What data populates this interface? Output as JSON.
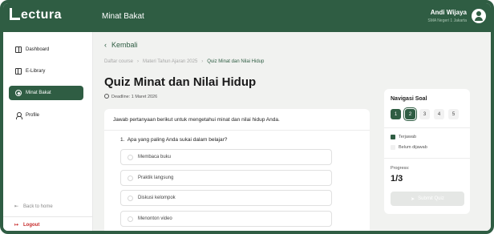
{
  "app": {
    "logo": "ectura",
    "logo_first_letter": "L"
  },
  "header": {
    "page_title": "Minat Bakat",
    "user_name": "Andi Wijaya",
    "user_school": "SMA Negeri 1 Jakarta"
  },
  "sidebar": {
    "items": [
      {
        "label": "Dashboard",
        "icon": "grid-icon"
      },
      {
        "label": "E-Library",
        "icon": "book-icon"
      },
      {
        "label": "Minat Bakat",
        "icon": "compass-icon",
        "active": true
      },
      {
        "label": "Profile",
        "icon": "user-icon"
      }
    ],
    "back_home": "Back to home",
    "logout": "Logout"
  },
  "main": {
    "back_label": "Kembali",
    "breadcrumb": [
      "Daftar course",
      "Materi Tahun Ajaran 2025",
      "Quiz Minat dan Nilai Hidup"
    ],
    "title": "Quiz Minat dan Nilai Hidup",
    "deadline": "Deadline: 1 Maret 2026",
    "instruction": "Jawab pertanyaan berikut untuk mengetahui minat dan nilai hidup Anda.",
    "question_number": "1.",
    "question": "Apa yang paling Anda sukai dalam belajar?",
    "options": [
      "Membaca buku",
      "Praktik langsung",
      "Diskusi kelompok",
      "Menonton video"
    ]
  },
  "navigation": {
    "title": "Navigasi Soal",
    "numbers": [
      "1",
      "2",
      "3",
      "4",
      "5"
    ],
    "legend_answered": "Terjawab",
    "legend_unanswered": "Belum dijawab",
    "progress_label": "Progress:",
    "progress_value": "1/3",
    "submit_label": "Submit Quiz"
  },
  "colors": {
    "brand": "#2f5d43",
    "logout": "#c62828",
    "background": "#f1f2f0"
  }
}
